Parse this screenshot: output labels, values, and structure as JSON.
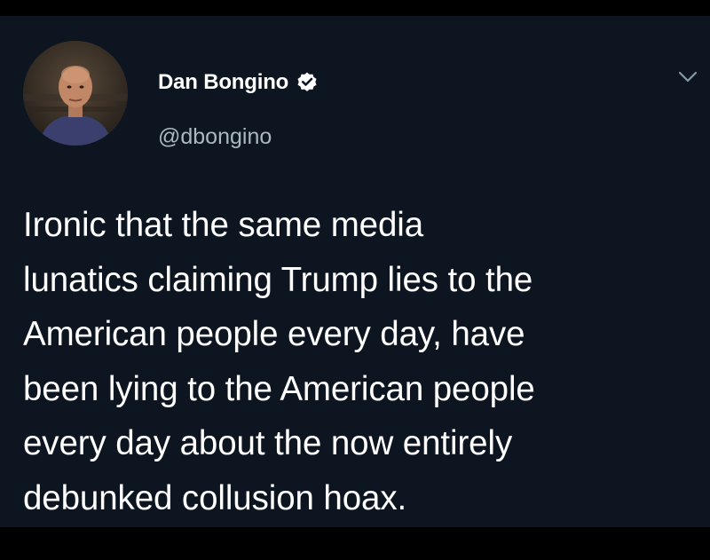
{
  "tweet": {
    "author": {
      "display_name": "Dan Bongino",
      "handle": "@dbongino",
      "verified": true
    },
    "text_lines": [
      "Ironic that the same media",
      "lunatics claiming Trump lies to the",
      "American people every day, have",
      "been lying to the American people",
      "every day about the now entirely",
      "debunked collusion hoax."
    ]
  },
  "colors": {
    "background": "#0c1520",
    "text_primary": "#ffffff",
    "text_secondary": "#aab8c2"
  },
  "icons": {
    "verified": "verified-badge-icon",
    "menu": "chevron-down-icon"
  }
}
